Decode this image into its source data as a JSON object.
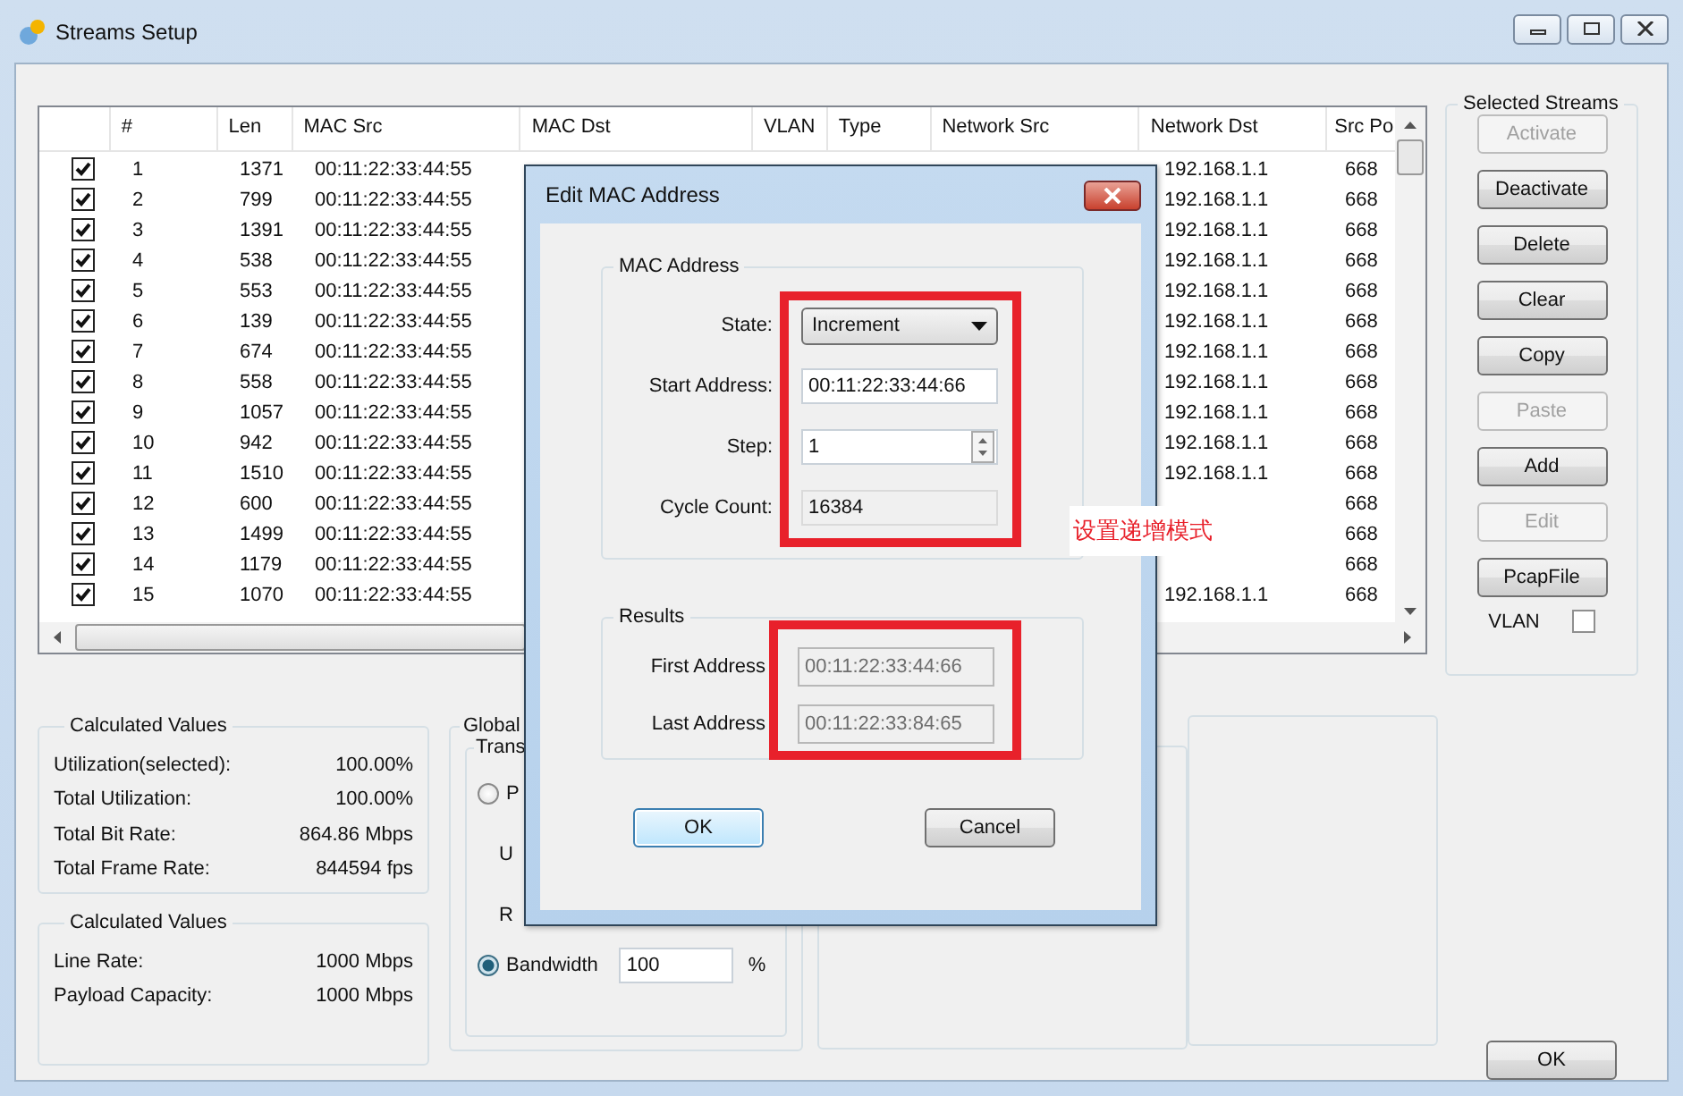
{
  "window": {
    "title": "Streams Setup"
  },
  "streams_table": {
    "columns": [
      "#",
      "Len",
      "MAC Src",
      "MAC Dst",
      "VLAN",
      "Type",
      "Network Src",
      "Network Dst",
      "Src Po"
    ],
    "rows": [
      {
        "checked": true,
        "cells": [
          "1",
          "1371",
          "00:11:22:33:44:55",
          "",
          "",
          "",
          "",
          "192.168.1.1",
          "668"
        ]
      },
      {
        "checked": true,
        "cells": [
          "2",
          "799",
          "00:11:22:33:44:55",
          "",
          "",
          "",
          "",
          "192.168.1.1",
          "668"
        ]
      },
      {
        "checked": true,
        "cells": [
          "3",
          "1391",
          "00:11:22:33:44:55",
          "",
          "",
          "",
          "",
          "192.168.1.1",
          "668"
        ]
      },
      {
        "checked": true,
        "cells": [
          "4",
          "538",
          "00:11:22:33:44:55",
          "",
          "",
          "",
          "",
          "192.168.1.1",
          "668"
        ]
      },
      {
        "checked": true,
        "cells": [
          "5",
          "553",
          "00:11:22:33:44:55",
          "",
          "",
          "",
          "",
          "192.168.1.1",
          "668"
        ]
      },
      {
        "checked": true,
        "cells": [
          "6",
          "139",
          "00:11:22:33:44:55",
          "",
          "",
          "",
          "",
          "192.168.1.1",
          "668"
        ]
      },
      {
        "checked": true,
        "cells": [
          "7",
          "674",
          "00:11:22:33:44:55",
          "",
          "",
          "",
          "",
          "192.168.1.1",
          "668"
        ]
      },
      {
        "checked": true,
        "cells": [
          "8",
          "558",
          "00:11:22:33:44:55",
          "",
          "",
          "",
          "",
          "192.168.1.1",
          "668"
        ]
      },
      {
        "checked": true,
        "cells": [
          "9",
          "1057",
          "00:11:22:33:44:55",
          "",
          "",
          "",
          "",
          "192.168.1.1",
          "668"
        ]
      },
      {
        "checked": true,
        "cells": [
          "10",
          "942",
          "00:11:22:33:44:55",
          "",
          "",
          "",
          "",
          "192.168.1.1",
          "668"
        ]
      },
      {
        "checked": true,
        "cells": [
          "11",
          "1510",
          "00:11:22:33:44:55",
          "",
          "",
          "",
          "",
          "192.168.1.1",
          "668"
        ]
      },
      {
        "checked": true,
        "cells": [
          "12",
          "600",
          "00:11:22:33:44:55",
          "",
          "",
          "",
          "",
          "",
          "668"
        ]
      },
      {
        "checked": true,
        "cells": [
          "13",
          "1499",
          "00:11:22:33:44:55",
          "",
          "",
          "",
          "",
          "",
          "668"
        ]
      },
      {
        "checked": true,
        "cells": [
          "14",
          "1179",
          "00:11:22:33:44:55",
          "",
          "",
          "",
          "",
          "",
          "668"
        ]
      },
      {
        "checked": true,
        "cells": [
          "15",
          "1070",
          "00:11:22:33:44:55",
          "",
          "",
          "",
          "",
          "192.168.1.1",
          "668"
        ]
      }
    ]
  },
  "selected_streams": {
    "title": "Selected Streams",
    "buttons": [
      {
        "label": "Activate",
        "disabled": true
      },
      {
        "label": "Deactivate",
        "disabled": false
      },
      {
        "label": "Delete",
        "disabled": false
      },
      {
        "label": "Clear",
        "disabled": false
      },
      {
        "label": "Copy",
        "disabled": false
      },
      {
        "label": "Paste",
        "disabled": true
      },
      {
        "label": "Add",
        "disabled": false
      },
      {
        "label": "Edit",
        "disabled": true
      },
      {
        "label": "PcapFile",
        "disabled": false
      }
    ],
    "vlan": {
      "label": "VLAN",
      "checked": false
    }
  },
  "calculated_groups": [
    {
      "title": "Calculated Values",
      "rows": [
        {
          "label": "Utilization(selected):",
          "value": "100.00%"
        },
        {
          "label": "Total Utilization:",
          "value": "100.00%"
        },
        {
          "label": "Total Bit Rate:",
          "value": "864.86 Mbps"
        },
        {
          "label": "Total Frame Rate:",
          "value": "844594 fps"
        }
      ]
    },
    {
      "title": "Calculated Values",
      "rows": [
        {
          "label": "Line Rate:",
          "value": "1000 Mbps"
        },
        {
          "label": "Payload Capacity:",
          "value": "1000 Mbps"
        }
      ]
    }
  ],
  "global": {
    "title": "Global",
    "subgroup_title": "Trans",
    "options": [
      {
        "label": "P",
        "selected": false
      },
      {
        "label": "Bandwidth",
        "selected": true,
        "value": "100",
        "unit": "%"
      }
    ],
    "labels": [
      "U",
      "R"
    ]
  },
  "ok_button": "OK",
  "dialog": {
    "title": "Edit MAC Address",
    "mac_group": {
      "title": "MAC Address",
      "fields": [
        {
          "kind": "dropdown",
          "label": "State:",
          "value": "Increment"
        },
        {
          "kind": "text",
          "label": "Start Address:",
          "value": "00:11:22:33:44:66"
        },
        {
          "kind": "spinner",
          "label": "Step:",
          "value": "1"
        },
        {
          "kind": "readonly",
          "label": "Cycle Count:",
          "value": "16384"
        }
      ]
    },
    "results_group": {
      "title": "Results",
      "fields": [
        {
          "kind": "disabled",
          "label": "First Address",
          "value": "00:11:22:33:44:66"
        },
        {
          "kind": "disabled",
          "label": "Last Address",
          "value": "00:11:22:33:84:65"
        }
      ]
    },
    "ok": "OK",
    "cancel": "Cancel"
  },
  "annotation": "设置递增模式"
}
